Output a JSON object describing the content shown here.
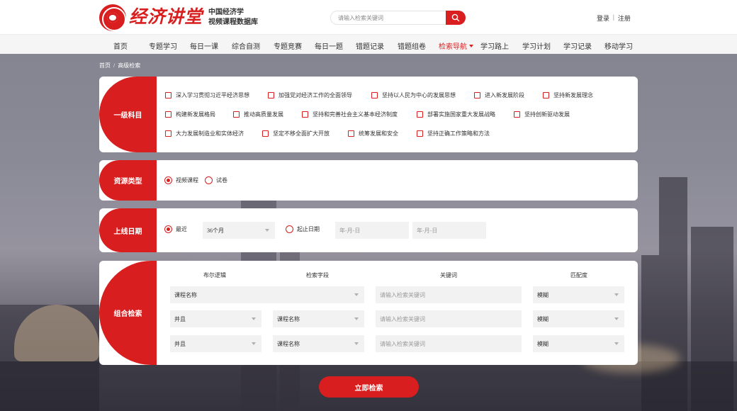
{
  "header": {
    "brand": "经济讲堂",
    "subtitle_line1": "中国经济学",
    "subtitle_line2": "视频课程数据库",
    "search_placeholder": "请输入检索关键词",
    "login": "登录",
    "separator": "|",
    "register": "注册"
  },
  "nav": {
    "items": [
      "首页",
      "专题学习",
      "每日一课",
      "综合自测",
      "专题竞赛",
      "每日一题",
      "错题记录",
      "错题组卷",
      "检索导航",
      "学习路上",
      "学习计划",
      "学习记录",
      "移动学习"
    ],
    "active_index": 8
  },
  "breadcrumb": {
    "home": "首页",
    "sep": "/",
    "current": "高级检索"
  },
  "subject": {
    "label": "一级科目",
    "row1": [
      "深入学习贯彻习近平经济思想",
      "加强党对经济工作的全面领导",
      "坚持以人民为中心的发展思想",
      "进入新发展阶段",
      "坚持新发展理念"
    ],
    "row2": [
      "构建新发展格局",
      "推动高质量发展",
      "坚持和完善社会主义基本经济制度",
      "部署实施国家重大发展战略",
      "坚持创新驱动发展"
    ],
    "row3": [
      "大力发展制造业和实体经济",
      "坚定不移全面扩大开放",
      "统筹发展和安全",
      "坚持正确工作策略和方法"
    ]
  },
  "resource": {
    "label": "资源类型",
    "options": [
      "视频课程",
      "试卷"
    ],
    "selected": 0
  },
  "date": {
    "label": "上线日期",
    "recent": "最近",
    "recent_value": "36个月",
    "range": "起止日期",
    "start_placeholder": "年-月-日",
    "end_placeholder": "年-月-日",
    "selected": 0
  },
  "combo": {
    "label": "组合检索",
    "headers": [
      "布尔逻辑",
      "检索字段",
      "关键词",
      "匹配度"
    ],
    "rows": [
      {
        "field": "课程名称",
        "keyword": "请输入检索关键词",
        "match": "模糊"
      },
      {
        "bool": "并且",
        "field": "课程名称",
        "keyword": "请输入检索关键词",
        "match": "模糊"
      },
      {
        "bool": "并且",
        "field": "课程名称",
        "keyword": "请输入检索关键词",
        "match": "模糊"
      }
    ]
  },
  "submit_label": "立即检索",
  "colors": {
    "accent": "#d81e1e"
  },
  "icons": {
    "search": "search-icon",
    "logo": "logo-seal-icon",
    "dropdown": "chevron-down-icon"
  }
}
